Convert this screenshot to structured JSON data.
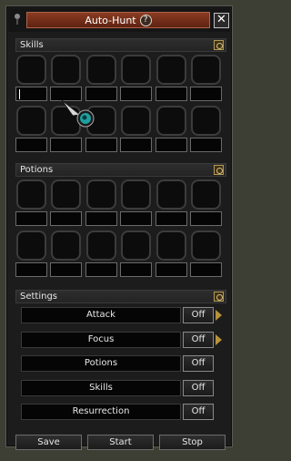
{
  "window": {
    "title": "Auto-Hunt",
    "help_label": "?",
    "close_label": "✕"
  },
  "sections": {
    "skills": {
      "label": "Skills"
    },
    "potions": {
      "label": "Potions"
    },
    "settings": {
      "label": "Settings"
    }
  },
  "skills_slots": 12,
  "potions_slots": 12,
  "settings": [
    {
      "label": "Attack",
      "toggle": "Off",
      "has_arrow": true
    },
    {
      "label": "Focus",
      "toggle": "Off",
      "has_arrow": true
    },
    {
      "label": "Potions",
      "toggle": "Off",
      "has_arrow": false
    },
    {
      "label": "Skills",
      "toggle": "Off",
      "has_arrow": false
    },
    {
      "label": "Resurrection",
      "toggle": "Off",
      "has_arrow": false
    }
  ],
  "buttons": {
    "save": "Save",
    "start": "Start",
    "stop": "Stop"
  },
  "colors": {
    "title_bar": "#8a3c22",
    "accent_gold": "#b8923a",
    "cursor_teal": "#1fa0a0"
  },
  "icons": {
    "pin": "pin-icon",
    "help": "help-icon",
    "close": "close-icon",
    "section": "gear-icon",
    "expand": "arrow-right-icon",
    "pointer": "mouse-pointer-icon"
  }
}
